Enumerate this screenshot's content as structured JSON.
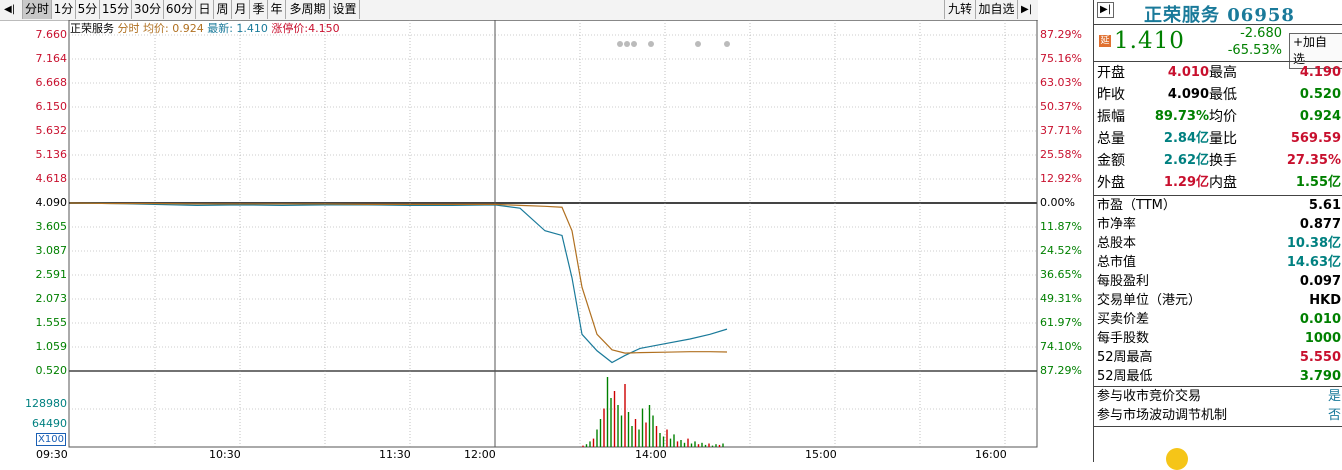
{
  "toolbar": {
    "tabs": [
      "分时",
      "1分",
      "5分",
      "15分",
      "30分",
      "60分",
      "日",
      "周",
      "月",
      "季",
      "年",
      "多周期",
      "设置"
    ],
    "active_tab": "分时",
    "right_buttons": [
      "九转",
      "加自选"
    ]
  },
  "chart": {
    "legend": {
      "name": "正荣服务",
      "mode": "分时",
      "avg_label": "均价: 0.924",
      "last_label": "最新: 1.410",
      "limit_label": "涨停价:4.150"
    },
    "price_ticks": [
      "7.660",
      "7.164",
      "6.668",
      "6.150",
      "5.632",
      "5.136",
      "4.618",
      "4.090",
      "3.605",
      "3.087",
      "2.591",
      "2.073",
      "1.555",
      "1.059",
      "0.520"
    ],
    "pct_ticks": [
      "87.29%",
      "75.16%",
      "63.03%",
      "50.37%",
      "37.71%",
      "25.58%",
      "12.92%",
      "0.00%",
      "11.87%",
      "24.52%",
      "36.65%",
      "49.31%",
      "61.97%",
      "74.10%",
      "87.29%"
    ],
    "volume_ticks": [
      "128980",
      "64490"
    ],
    "volume_unit": "X100",
    "time_labels": [
      "09:30",
      "10:30",
      "11:30",
      "12:00",
      "14:00",
      "15:00",
      "16:00"
    ],
    "colors": {
      "up": "#cc0000",
      "down": "#008000",
      "price_line": "#1a7a9a",
      "avg_line": "#b07020",
      "grid": "#999999"
    }
  },
  "quote": {
    "name": "正荣服务",
    "code": "06958",
    "badge": "延",
    "price": "1.410",
    "change": "-2.680",
    "change_pct": "-65.53%",
    "add_button": "+加自选",
    "stats": [
      {
        "k1": "开盘",
        "v1": "4.010",
        "k2": "最高",
        "v2": "4.190",
        "c1": "red",
        "c2": "red"
      },
      {
        "k1": "昨收",
        "v1": "4.090",
        "k2": "最低",
        "v2": "0.520",
        "c1": "black",
        "c2": "green"
      },
      {
        "k1": "振幅",
        "v1": "89.73%",
        "k2": "均价",
        "v2": "0.924",
        "c1": "green",
        "c2": "green"
      },
      {
        "k1": "总量",
        "v1": "2.84亿",
        "k2": "量比",
        "v2": "569.59",
        "c1": "teal",
        "c2": "red"
      },
      {
        "k1": "金额",
        "v1": "2.62亿",
        "k2": "换手",
        "v2": "27.35%",
        "c1": "teal",
        "c2": "red"
      },
      {
        "k1": "外盘",
        "v1": "1.29亿",
        "k2": "内盘",
        "v2": "1.55亿",
        "c1": "red",
        "c2": "green"
      }
    ],
    "fundamentals": [
      {
        "k": "市盈（TTM）",
        "v": "5.61",
        "c": "black"
      },
      {
        "k": "市净率",
        "v": "0.877",
        "c": "black"
      },
      {
        "k": "总股本",
        "v": "10.38亿",
        "c": "teal"
      },
      {
        "k": "总市值",
        "v": "14.63亿",
        "c": "teal"
      },
      {
        "k": "每股盈利",
        "v": "0.097",
        "c": "black"
      },
      {
        "k": "交易单位（港元）",
        "v": "HKD",
        "c": "black"
      },
      {
        "k": "买卖价差",
        "v": "0.010",
        "c": "green"
      },
      {
        "k": "每手股数",
        "v": "1000",
        "c": "green"
      },
      {
        "k": "52周最高",
        "v": "5.550",
        "c": "red"
      },
      {
        "k": "52周最低",
        "v": "3.790",
        "c": "green"
      }
    ],
    "flags": [
      {
        "k": "参与收市竞价交易",
        "v": "是"
      },
      {
        "k": "参与市场波动调节机制",
        "v": "否"
      }
    ]
  },
  "chart_data": {
    "type": "line",
    "x": [
      "09:30",
      "09:45",
      "10:00",
      "10:15",
      "10:30",
      "10:45",
      "11:00",
      "11:15",
      "11:30",
      "11:45",
      "12:00",
      "13:00",
      "13:10",
      "13:20",
      "13:30",
      "13:35",
      "13:40",
      "13:45",
      "13:50",
      "14:00",
      "14:10",
      "14:20",
      "14:30",
      "14:40"
    ],
    "series": [
      {
        "name": "最新",
        "values": [
          4.09,
          4.08,
          4.06,
          4.04,
          4.05,
          4.04,
          4.05,
          4.05,
          4.04,
          4.04,
          4.05,
          3.98,
          3.5,
          3.4,
          2.5,
          1.3,
          0.95,
          0.7,
          0.85,
          1.0,
          1.1,
          1.2,
          1.3,
          1.41
        ]
      },
      {
        "name": "均价",
        "values": [
          4.09,
          4.08,
          4.08,
          4.07,
          4.07,
          4.07,
          4.07,
          4.06,
          4.06,
          4.06,
          4.06,
          4.04,
          4.02,
          4.0,
          3.5,
          2.3,
          1.3,
          0.97,
          0.9,
          0.91,
          0.92,
          0.93,
          0.93,
          0.924
        ]
      }
    ],
    "ylim": [
      0.52,
      7.66
    ],
    "prev_close": 4.09,
    "volume": [
      2,
      4,
      8,
      12,
      25,
      40,
      55,
      100,
      70,
      80,
      60,
      45,
      90,
      50,
      30,
      40,
      25,
      55,
      35,
      60,
      45,
      30,
      20,
      15,
      25,
      12,
      18,
      8,
      10,
      6,
      12,
      5,
      8,
      4,
      6,
      3,
      5,
      2,
      4,
      3,
      5
    ],
    "volume_ylim": [
      0,
      128980
    ]
  }
}
